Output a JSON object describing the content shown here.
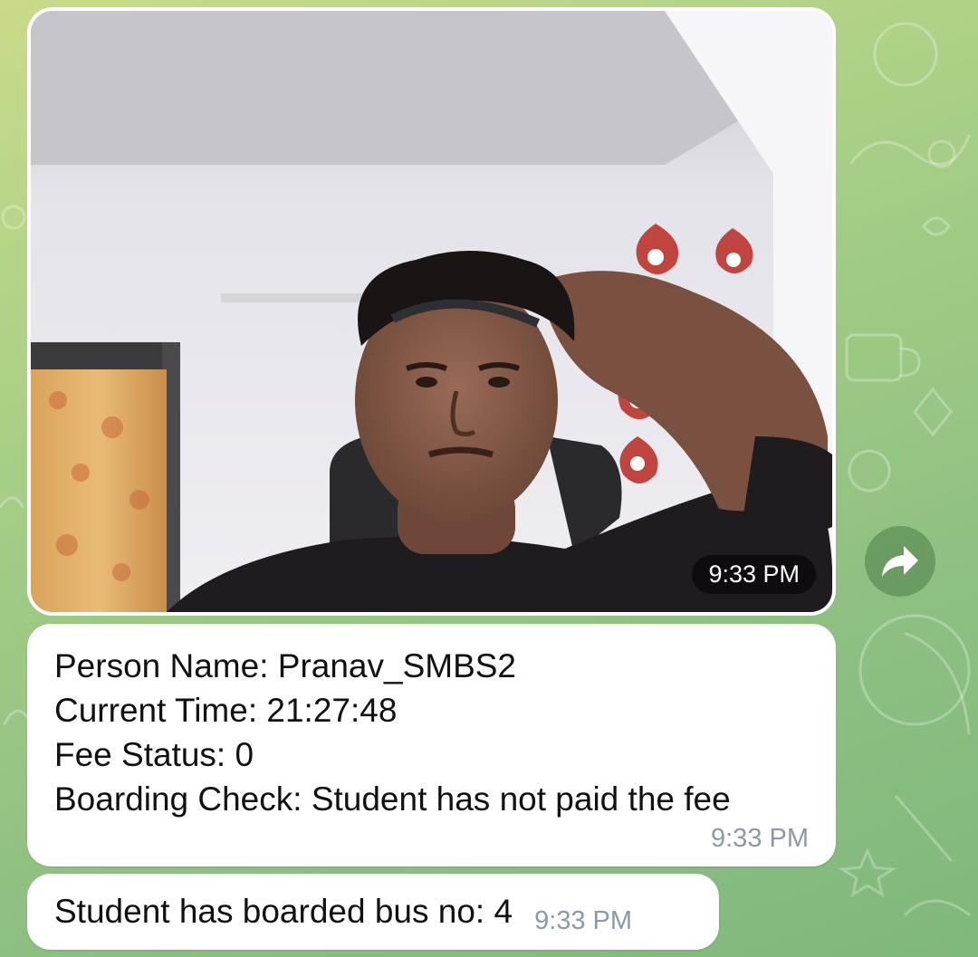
{
  "photo_message": {
    "time": "9:33 PM"
  },
  "info_message": {
    "lines": [
      "Person Name: Pranav_SMBS2",
      "Current Time: 21:27:48",
      "Fee Status: 0",
      "Boarding Check: Student has not paid the fee"
    ],
    "time": "9:33 PM"
  },
  "boarding_message": {
    "text": "Student has boarded bus no: 4",
    "time": "9:33 PM"
  },
  "icons": {
    "forward": "share-arrow-icon"
  },
  "colors": {
    "bubble": "#ffffff",
    "timestamp": "#8a9aa6",
    "wallpaper_start": "#c9db8a",
    "wallpaper_end": "#7fb87c"
  }
}
